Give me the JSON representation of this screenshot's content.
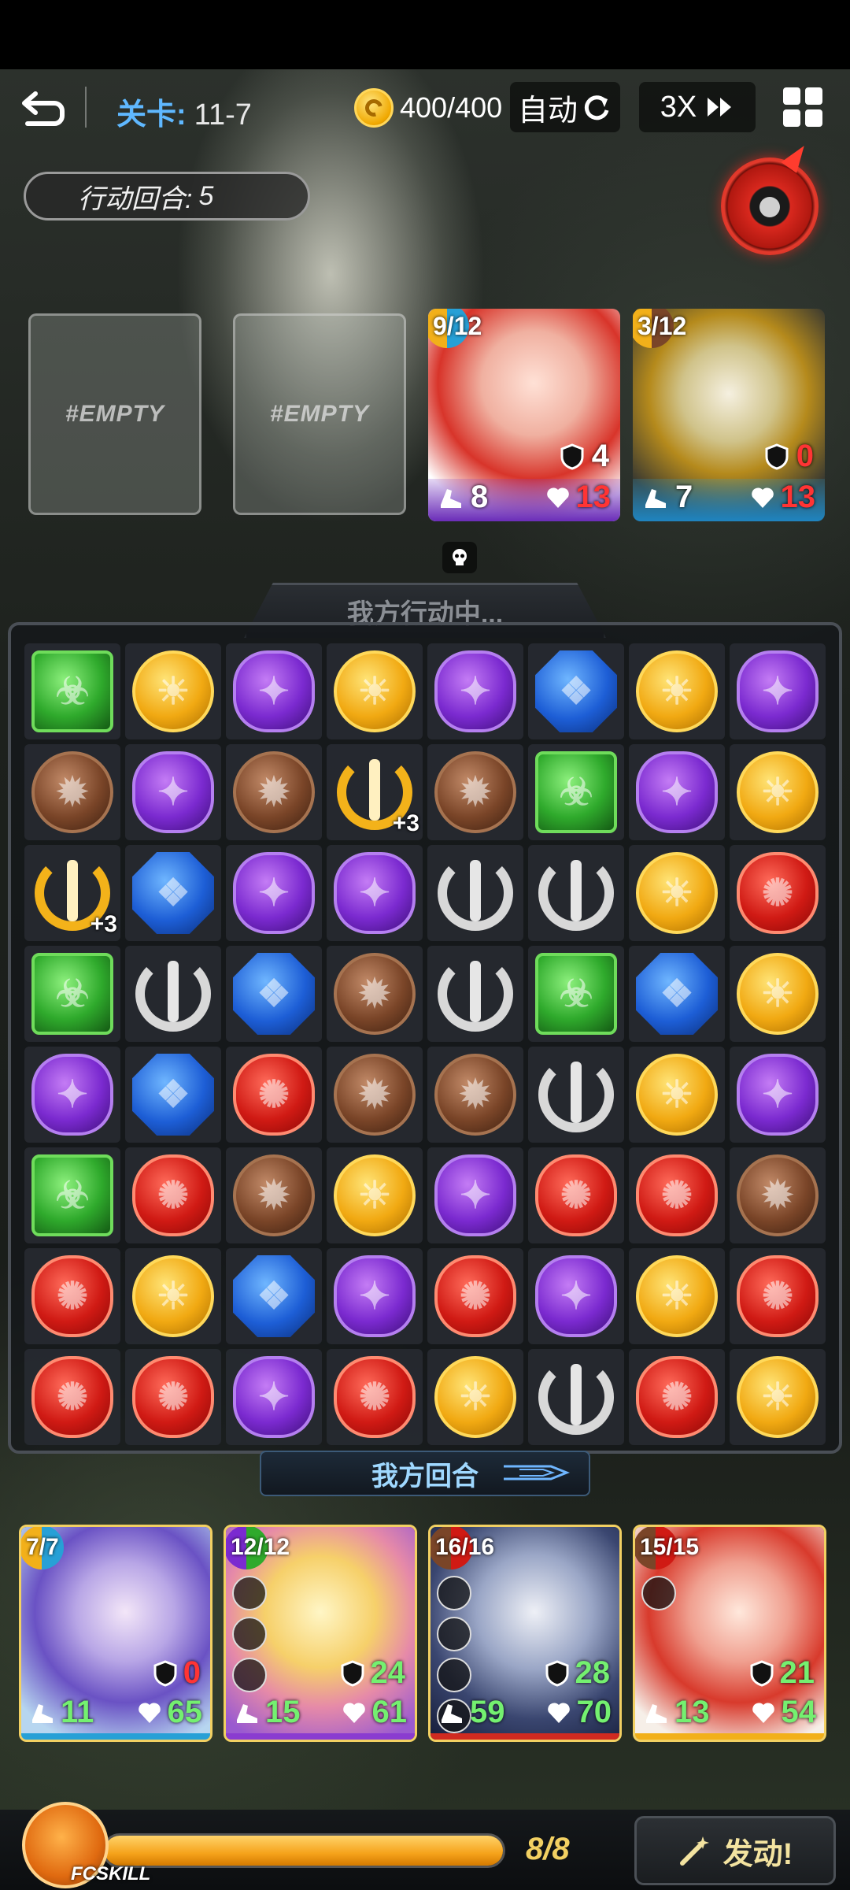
{
  "topbar": {
    "stage_label": "关卡:",
    "stage_value": "11-7",
    "energy": "400/400",
    "auto_label": "自动",
    "speed_label": "3X"
  },
  "action_turns": {
    "label": "行动回合:",
    "value": "5"
  },
  "enemy_slots": [
    {
      "label": "#EMPTY"
    },
    {
      "label": "#EMPTY"
    }
  ],
  "enemies": [
    {
      "charge": "9/12",
      "atk": "8",
      "def": "4",
      "hp": "13",
      "color": "#7b3cc6"
    },
    {
      "charge": "3/12",
      "atk": "7",
      "def": "0",
      "hp": "13",
      "color": "#27a0d6"
    }
  ],
  "board_status": "我方行动中...",
  "board": [
    [
      "green",
      "yellow",
      "purple",
      "yellow",
      "purple",
      "blue",
      "yellow",
      "purple"
    ],
    [
      "brown",
      "purple",
      "brown",
      "gold+3",
      "brown",
      "green",
      "purple",
      "yellow"
    ],
    [
      "gold+3",
      "blue",
      "purple",
      "purple",
      "silver",
      "silver",
      "yellow",
      "red"
    ],
    [
      "green",
      "silver",
      "blue",
      "brown",
      "silver",
      "green",
      "blue",
      "yellow"
    ],
    [
      "purple",
      "blue",
      "red",
      "brown",
      "brown",
      "silver",
      "yellow",
      "purple"
    ],
    [
      "green",
      "red",
      "brown",
      "yellow",
      "purple",
      "red",
      "red",
      "brown"
    ],
    [
      "red",
      "yellow",
      "blue",
      "purple",
      "red",
      "purple",
      "yellow",
      "red"
    ],
    [
      "red",
      "red",
      "purple",
      "red",
      "yellow",
      "silver",
      "red",
      "yellow"
    ]
  ],
  "board_plus_label": "+3",
  "turn_banner": "我方回合",
  "heroes": [
    {
      "charge": "7/7",
      "atk": "11",
      "def": "0",
      "hp": "65",
      "strip": "#27a0d6"
    },
    {
      "charge": "12/12",
      "atk": "15",
      "def": "24",
      "hp": "61",
      "strip": "#8a3cd0"
    },
    {
      "charge": "16/16",
      "atk": "59",
      "def": "28",
      "hp": "70",
      "strip": "#d02a20"
    },
    {
      "charge": "15/15",
      "atk": "13",
      "def": "21",
      "hp": "54",
      "strip": "#f2b01a"
    }
  ],
  "fcskill": {
    "label": "FCSKILL",
    "count": "8/8",
    "fill_fraction": 1.0
  },
  "launch_button": "发动!"
}
